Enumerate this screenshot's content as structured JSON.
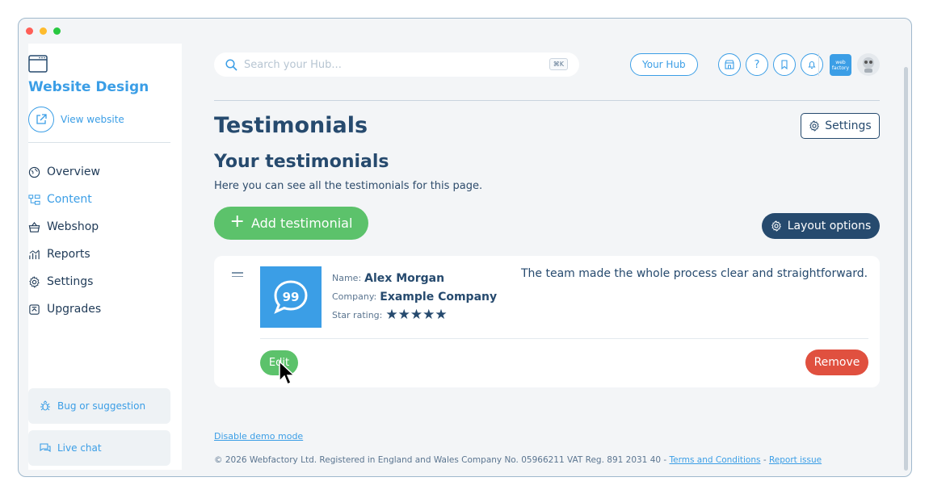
{
  "sidebar": {
    "site_title": "Website Design",
    "view_website": "View website",
    "nav": [
      {
        "label": "Overview",
        "icon": "globe-icon",
        "active": false
      },
      {
        "label": "Content",
        "icon": "content-tree-icon",
        "active": true
      },
      {
        "label": "Webshop",
        "icon": "basket-icon",
        "active": false
      },
      {
        "label": "Reports",
        "icon": "chart-icon",
        "active": false
      },
      {
        "label": "Settings",
        "icon": "gear-icon",
        "active": false
      },
      {
        "label": "Upgrades",
        "icon": "upgrade-box-icon",
        "active": false
      }
    ],
    "bug_label": "Bug or suggestion",
    "chat_label": "Live chat"
  },
  "header": {
    "search_placeholder": "Search your Hub...",
    "search_shortcut": "⌘K",
    "hub_label": "Your Hub",
    "help_label": "?",
    "brand_logo_text": "web factory"
  },
  "main": {
    "page_title": "Testimonials",
    "settings_label": "Settings",
    "section_title": "Your testimonials",
    "section_desc": "Here you can see all the testimonials for this page.",
    "add_label": "Add testimonial",
    "layout_label": "Layout options"
  },
  "testimonial": {
    "name_label": "Name:",
    "name": "Alex Morgan",
    "company_label": "Company:",
    "company": "Example Company",
    "rating_label": "Star rating:",
    "rating": 5,
    "stars": "★★★★★",
    "quote": "The team made the whole process clear and straightforward.",
    "thumb_text": "99",
    "edit_label": "Edit",
    "remove_label": "Remove"
  },
  "footer": {
    "demo_link": "Disable demo mode",
    "copyright": "© 2026 Webfactory Ltd. Registered in England and Wales Company No. 05966211 VAT Reg. 891 2031 40 -",
    "terms": "Terms and Conditions",
    "separator": "-",
    "report": "Report issue"
  },
  "colors": {
    "accent": "#3b9ee6",
    "navy": "#264a6e",
    "green": "#5cc26b",
    "red": "#e0503f",
    "background": "#f3f5f7"
  }
}
